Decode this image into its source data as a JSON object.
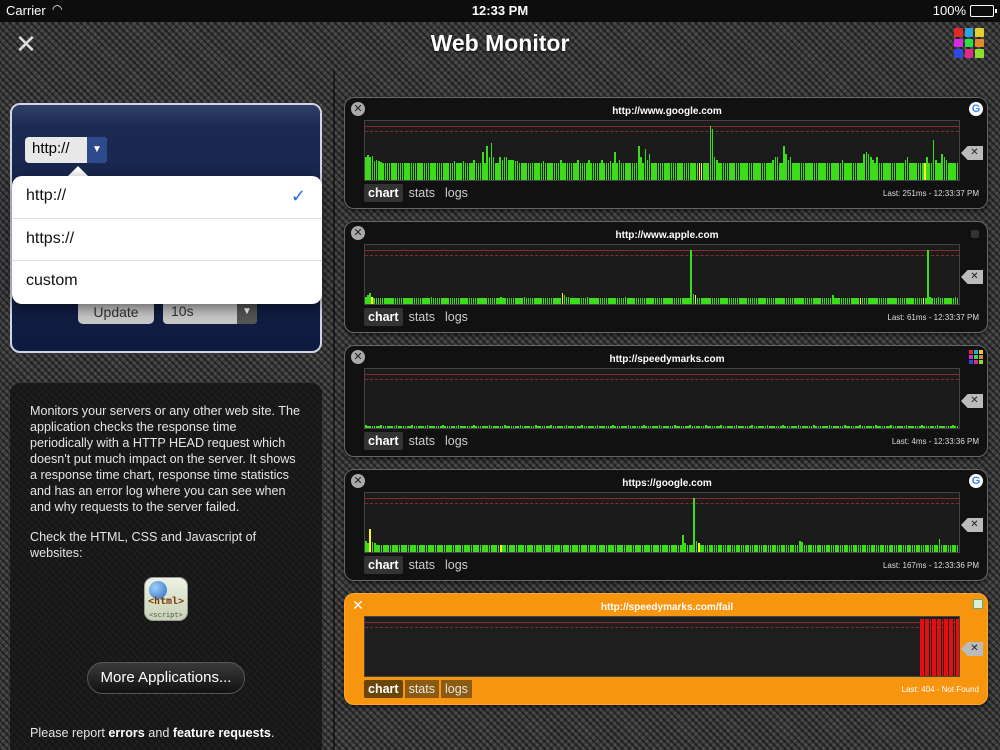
{
  "status": {
    "carrier": "Carrier",
    "time": "12:33 PM",
    "battery": "100%"
  },
  "nav": {
    "title": "Web Monitor",
    "grid_colors": [
      "#e02a2a",
      "#2aa5e0",
      "#e0d22a",
      "#d42ae0",
      "#2ae046",
      "#e08a2a",
      "#2a4ae0",
      "#e02a8a",
      "#8ae02a"
    ]
  },
  "settings": {
    "protocol_value": "http://",
    "update_label": "Update",
    "interval_value": "10s",
    "options": [
      {
        "label": "http://",
        "selected": true
      },
      {
        "label": "https://",
        "selected": false
      },
      {
        "label": "custom",
        "selected": false
      }
    ],
    "check_glyph": "✓"
  },
  "info": {
    "description": "Monitors your servers or any other web site. The application checks the response time periodically with a HTTP HEAD request which doesn't put much impact on the server. It shows a response time chart, response time statistics and has an error log where you can see when and why requests to the server failed.",
    "check_text": "Check the HTML, CSS and Javascript of websites:",
    "icon_tag1": "<html>",
    "icon_tag2": "<script>",
    "more_button": "More Applications...",
    "report_prefix": "Please report ",
    "report_errors": "errors",
    "report_and": " and ",
    "report_features": "feature requests",
    "report_suffix": "."
  },
  "tabs": {
    "chart": "chart",
    "stats": "stats",
    "logs": "logs"
  },
  "monitors": [
    {
      "url": "http://www.google.com",
      "favicon": "google",
      "status": "Last: 251ms - 12:33:37 PM",
      "fail": false,
      "values": [
        0.4,
        0.44,
        0.4,
        0.42,
        0.33,
        0.35,
        0.33,
        0.32,
        0.3,
        0.3,
        0.3,
        0.3,
        0.3,
        0.3,
        0.3,
        0.3,
        0.3,
        0.3,
        0.3,
        0.3,
        0.3,
        0.3,
        0.3,
        0.3,
        0.3,
        0.3,
        0.3,
        0.3,
        0.3,
        0.3,
        0.3,
        0.3,
        0.3,
        0.3,
        0.3,
        0.3,
        0.3,
        0.3,
        0.3,
        0.3,
        0.3,
        0.33,
        0.3,
        0.3,
        0.3,
        0.34,
        0.3,
        0.3,
        0.3,
        0.3,
        0.35,
        0.3,
        0.3,
        0.3,
        0.5,
        0.3,
        0.6,
        0.4,
        0.65,
        0.4,
        0.3,
        0.3,
        0.4,
        0.35,
        0.4,
        0.4,
        0.35,
        0.35,
        0.35,
        0.33,
        0.33,
        0.3,
        0.3,
        0.3,
        0.3,
        0.3,
        0.3,
        0.3,
        0.3,
        0.3,
        0.3,
        0.3,
        0.33,
        0.3,
        0.3,
        0.3,
        0.3,
        0.3,
        0.3,
        0.3,
        0.35,
        0.3,
        0.3,
        0.3,
        0.3,
        0.3,
        0.3,
        0.3,
        0.35,
        0.3,
        0.3,
        0.3,
        0.3,
        0.35,
        0.3,
        0.3,
        0.3,
        0.3,
        0.3,
        0.35,
        0.3,
        0.3,
        0.3,
        0.33,
        0.3,
        0.5,
        0.3,
        0.35,
        0.3,
        0.3,
        0.3,
        0.3,
        0.3,
        0.3,
        0.3,
        0.3,
        0.6,
        0.4,
        0.3,
        0.55,
        0.35,
        0.45,
        0.3,
        0.3,
        0.3,
        0.3,
        0.3,
        0.3,
        0.3,
        0.3,
        0.3,
        0.3,
        0.3,
        0.3,
        0.3,
        0.3,
        0.3,
        0.3,
        0.3,
        0.3,
        0.3,
        0.3,
        0.3,
        0.3,
        0.3,
        0.3,
        0.3,
        0.3,
        0.3,
        0.95,
        0.9,
        0.4,
        0.35,
        0.3,
        0.3,
        0.3,
        0.3,
        0.3,
        0.3,
        0.3,
        0.3,
        0.3,
        0.3,
        0.3,
        0.3,
        0.3,
        0.3,
        0.3,
        0.3,
        0.3,
        0.3,
        0.3,
        0.3,
        0.3,
        0.3,
        0.3,
        0.3,
        0.3,
        0.35,
        0.4,
        0.4,
        0.3,
        0.3,
        0.6,
        0.45,
        0.35,
        0.4,
        0.3,
        0.3,
        0.3,
        0.3,
        0.3,
        0.3,
        0.3,
        0.3,
        0.3,
        0.3,
        0.3,
        0.3,
        0.3,
        0.3,
        0.3,
        0.3,
        0.3,
        0.3,
        0.3,
        0.3,
        0.3,
        0.3,
        0.3,
        0.35,
        0.3,
        0.3,
        0.3,
        0.3,
        0.3,
        0.3,
        0.3,
        0.3,
        0.3,
        0.45,
        0.5,
        0.45,
        0.4,
        0.35,
        0.3,
        0.4,
        0.3,
        0.3,
        0.3,
        0.3,
        0.3,
        0.3,
        0.3,
        0.3,
        0.3,
        0.3,
        0.3,
        0.3,
        0.35,
        0.4,
        0.3,
        0.3,
        0.3,
        0.3,
        0.3,
        0.3,
        0.3,
        0.3,
        0.4,
        0.3,
        0.3,
        0.7,
        0.35,
        0.3,
        0.3,
        0.45,
        0.4,
        0.35,
        0.3,
        0.3,
        0.3,
        0.3,
        0.3,
        0.3
      ],
      "highlights": {
        "154": "#f5f52a",
        "155": "#f5f52a",
        "258": "#f5f52a"
      }
    },
    {
      "url": "http://www.apple.com",
      "favicon": "apple",
      "status": "Last: 61ms - 12:33:37 PM",
      "fail": false,
      "values": [
        0.12,
        0.15,
        0.2,
        0.12,
        0.1,
        0.1,
        0.1,
        0.1,
        0.1,
        0.1,
        0.1,
        0.1,
        0.1,
        0.1,
        0.1,
        0.1,
        0.1,
        0.1,
        0.1,
        0.1,
        0.1,
        0.1,
        0.1,
        0.1,
        0.1,
        0.1,
        0.1,
        0.1,
        0.1,
        0.1,
        0.1,
        0.12,
        0.1,
        0.1,
        0.1,
        0.1,
        0.1,
        0.1,
        0.1,
        0.1,
        0.1,
        0.1,
        0.1,
        0.1,
        0.1,
        0.1,
        0.1,
        0.1,
        0.1,
        0.1,
        0.1,
        0.1,
        0.1,
        0.1,
        0.1,
        0.1,
        0.1,
        0.1,
        0.1,
        0.1,
        0.1,
        0.1,
        0.1,
        0.1,
        0.12,
        0.1,
        0.1,
        0.1,
        0.1,
        0.1,
        0.1,
        0.1,
        0.1,
        0.1,
        0.1,
        0.12,
        0.1,
        0.1,
        0.1,
        0.1,
        0.1,
        0.1,
        0.1,
        0.1,
        0.1,
        0.1,
        0.1,
        0.1,
        0.1,
        0.1,
        0.1,
        0.1,
        0.1,
        0.2,
        0.15,
        0.12,
        0.12,
        0.1,
        0.1,
        0.1,
        0.1,
        0.1,
        0.1,
        0.1,
        0.1,
        0.12,
        0.1,
        0.1,
        0.1,
        0.1,
        0.1,
        0.1,
        0.1,
        0.1,
        0.1,
        0.1,
        0.1,
        0.1,
        0.1,
        0.1,
        0.1,
        0.1,
        0.1,
        0.12,
        0.1,
        0.1,
        0.1,
        0.1,
        0.1,
        0.1,
        0.1,
        0.1,
        0.1,
        0.1,
        0.1,
        0.1,
        0.1,
        0.1,
        0.1,
        0.1,
        0.1,
        0.1,
        0.1,
        0.1,
        0.1,
        0.1,
        0.1,
        0.1,
        0.1,
        0.1,
        0.1,
        0.1,
        0.1,
        0.1,
        0.95,
        0.18,
        0.15,
        0.1,
        0.1,
        0.1,
        0.1,
        0.1,
        0.1,
        0.1,
        0.1,
        0.1,
        0.1,
        0.1,
        0.1,
        0.1,
        0.1,
        0.1,
        0.1,
        0.1,
        0.1,
        0.1,
        0.1,
        0.1,
        0.1,
        0.1,
        0.1,
        0.1,
        0.1,
        0.1,
        0.1,
        0.1,
        0.1,
        0.1,
        0.1,
        0.1,
        0.1,
        0.1,
        0.1,
        0.1,
        0.1,
        0.1,
        0.1,
        0.1,
        0.1,
        0.1,
        0.1,
        0.1,
        0.1,
        0.1,
        0.1,
        0.1,
        0.1,
        0.1,
        0.1,
        0.1,
        0.1,
        0.1,
        0.1,
        0.1,
        0.1,
        0.1,
        0.1,
        0.1,
        0.1,
        0.1,
        0.1,
        0.15,
        0.1,
        0.1,
        0.1,
        0.1,
        0.1,
        0.1,
        0.1,
        0.1,
        0.1,
        0.1,
        0.1,
        0.1,
        0.1,
        0.1,
        0.1,
        0.1,
        0.1,
        0.1,
        0.1,
        0.1,
        0.1,
        0.1,
        0.1,
        0.1,
        0.1,
        0.1,
        0.1,
        0.1,
        0.1,
        0.1,
        0.1,
        0.1,
        0.1,
        0.1,
        0.1,
        0.1,
        0.1,
        0.1,
        0.1,
        0.1,
        0.1,
        0.1,
        0.1,
        0.1,
        0.95,
        0.12,
        0.1,
        0.1,
        0.1,
        0.12,
        0.1,
        0.1,
        0.1,
        0.1,
        0.1,
        0.1,
        0.1,
        0.12,
        0.1,
        0.1
      ],
      "highlights": {
        "3": "#f5f52a",
        "93": "#f5f52a",
        "156": "#f5f52a",
        "234": "#f5f52a",
        "264": "#f5f52a"
      }
    },
    {
      "url": "http://speedymarks.com",
      "favicon": "grid",
      "status": "Last: 4ms - 12:33:36 PM",
      "fail": false,
      "values": "low",
      "highlights": {}
    },
    {
      "url": "https://google.com",
      "favicon": "google",
      "status": "Last: 167ms - 12:33:36 PM",
      "fail": false,
      "values": [
        0.2,
        0.15,
        0.4,
        0.18,
        0.15,
        0.12,
        0.12,
        0.12,
        0.12,
        0.12,
        0.12,
        0.12,
        0.12,
        0.12,
        0.12,
        0.12,
        0.12,
        0.12,
        0.12,
        0.12,
        0.12,
        0.12,
        0.12,
        0.12,
        0.12,
        0.12,
        0.12,
        0.12,
        0.12,
        0.12,
        0.12,
        0.12,
        0.12,
        0.12,
        0.12,
        0.12,
        0.12,
        0.12,
        0.12,
        0.12,
        0.12,
        0.12,
        0.12,
        0.12,
        0.12,
        0.12,
        0.12,
        0.12,
        0.12,
        0.12,
        0.12,
        0.12,
        0.12,
        0.12,
        0.12,
        0.12,
        0.12,
        0.12,
        0.12,
        0.12,
        0.12,
        0.12,
        0.12,
        0.12,
        0.12,
        0.12,
        0.12,
        0.12,
        0.12,
        0.12,
        0.12,
        0.12,
        0.12,
        0.12,
        0.12,
        0.12,
        0.12,
        0.12,
        0.12,
        0.12,
        0.12,
        0.12,
        0.12,
        0.12,
        0.12,
        0.12,
        0.12,
        0.12,
        0.12,
        0.12,
        0.12,
        0.12,
        0.12,
        0.12,
        0.12,
        0.12,
        0.12,
        0.12,
        0.12,
        0.12,
        0.12,
        0.12,
        0.12,
        0.12,
        0.12,
        0.12,
        0.12,
        0.12,
        0.12,
        0.12,
        0.12,
        0.12,
        0.12,
        0.12,
        0.12,
        0.12,
        0.12,
        0.12,
        0.12,
        0.12,
        0.12,
        0.12,
        0.12,
        0.12,
        0.12,
        0.12,
        0.12,
        0.12,
        0.12,
        0.12,
        0.12,
        0.12,
        0.12,
        0.12,
        0.12,
        0.12,
        0.12,
        0.12,
        0.12,
        0.12,
        0.12,
        0.3,
        0.15,
        0.12,
        0.12,
        0.12,
        0.95,
        0.2,
        0.15,
        0.12,
        0.12,
        0.12,
        0.12,
        0.12,
        0.12,
        0.12,
        0.12,
        0.12,
        0.12,
        0.12,
        0.12,
        0.12,
        0.12,
        0.12,
        0.12,
        0.12,
        0.12,
        0.12,
        0.12,
        0.12,
        0.12,
        0.12,
        0.12,
        0.12,
        0.12,
        0.12,
        0.12,
        0.12,
        0.12,
        0.12,
        0.12,
        0.12,
        0.12,
        0.12,
        0.12,
        0.12,
        0.12,
        0.12,
        0.12,
        0.12,
        0.12,
        0.12,
        0.12,
        0.2,
        0.18,
        0.12,
        0.12,
        0.12,
        0.12,
        0.12,
        0.12,
        0.12,
        0.12,
        0.12,
        0.12,
        0.12,
        0.12,
        0.12,
        0.12,
        0.12,
        0.12,
        0.12,
        0.12,
        0.12,
        0.12,
        0.12,
        0.12,
        0.12,
        0.12,
        0.12,
        0.12,
        0.12,
        0.12,
        0.12,
        0.12,
        0.12,
        0.12,
        0.12,
        0.12,
        0.12,
        0.12,
        0.12,
        0.12,
        0.12,
        0.12,
        0.12,
        0.12,
        0.12,
        0.12,
        0.12,
        0.12,
        0.12,
        0.12,
        0.12,
        0.12,
        0.12,
        0.12,
        0.12,
        0.12,
        0.12,
        0.12,
        0.12,
        0.12,
        0.12,
        0.12,
        0.22,
        0.12,
        0.12,
        0.12,
        0.12,
        0.12,
        0.12,
        0.12,
        0.12,
        0.12
      ],
      "highlights": {
        "2": "#f5f52a",
        "60": "#f5f52a",
        "148": "#f5f52a"
      }
    },
    {
      "url": "http://speedymarks.com/fail",
      "favicon": "image",
      "status": "Last: 404 - Not Found",
      "fail": true,
      "values": "fail",
      "highlights": {}
    }
  ]
}
